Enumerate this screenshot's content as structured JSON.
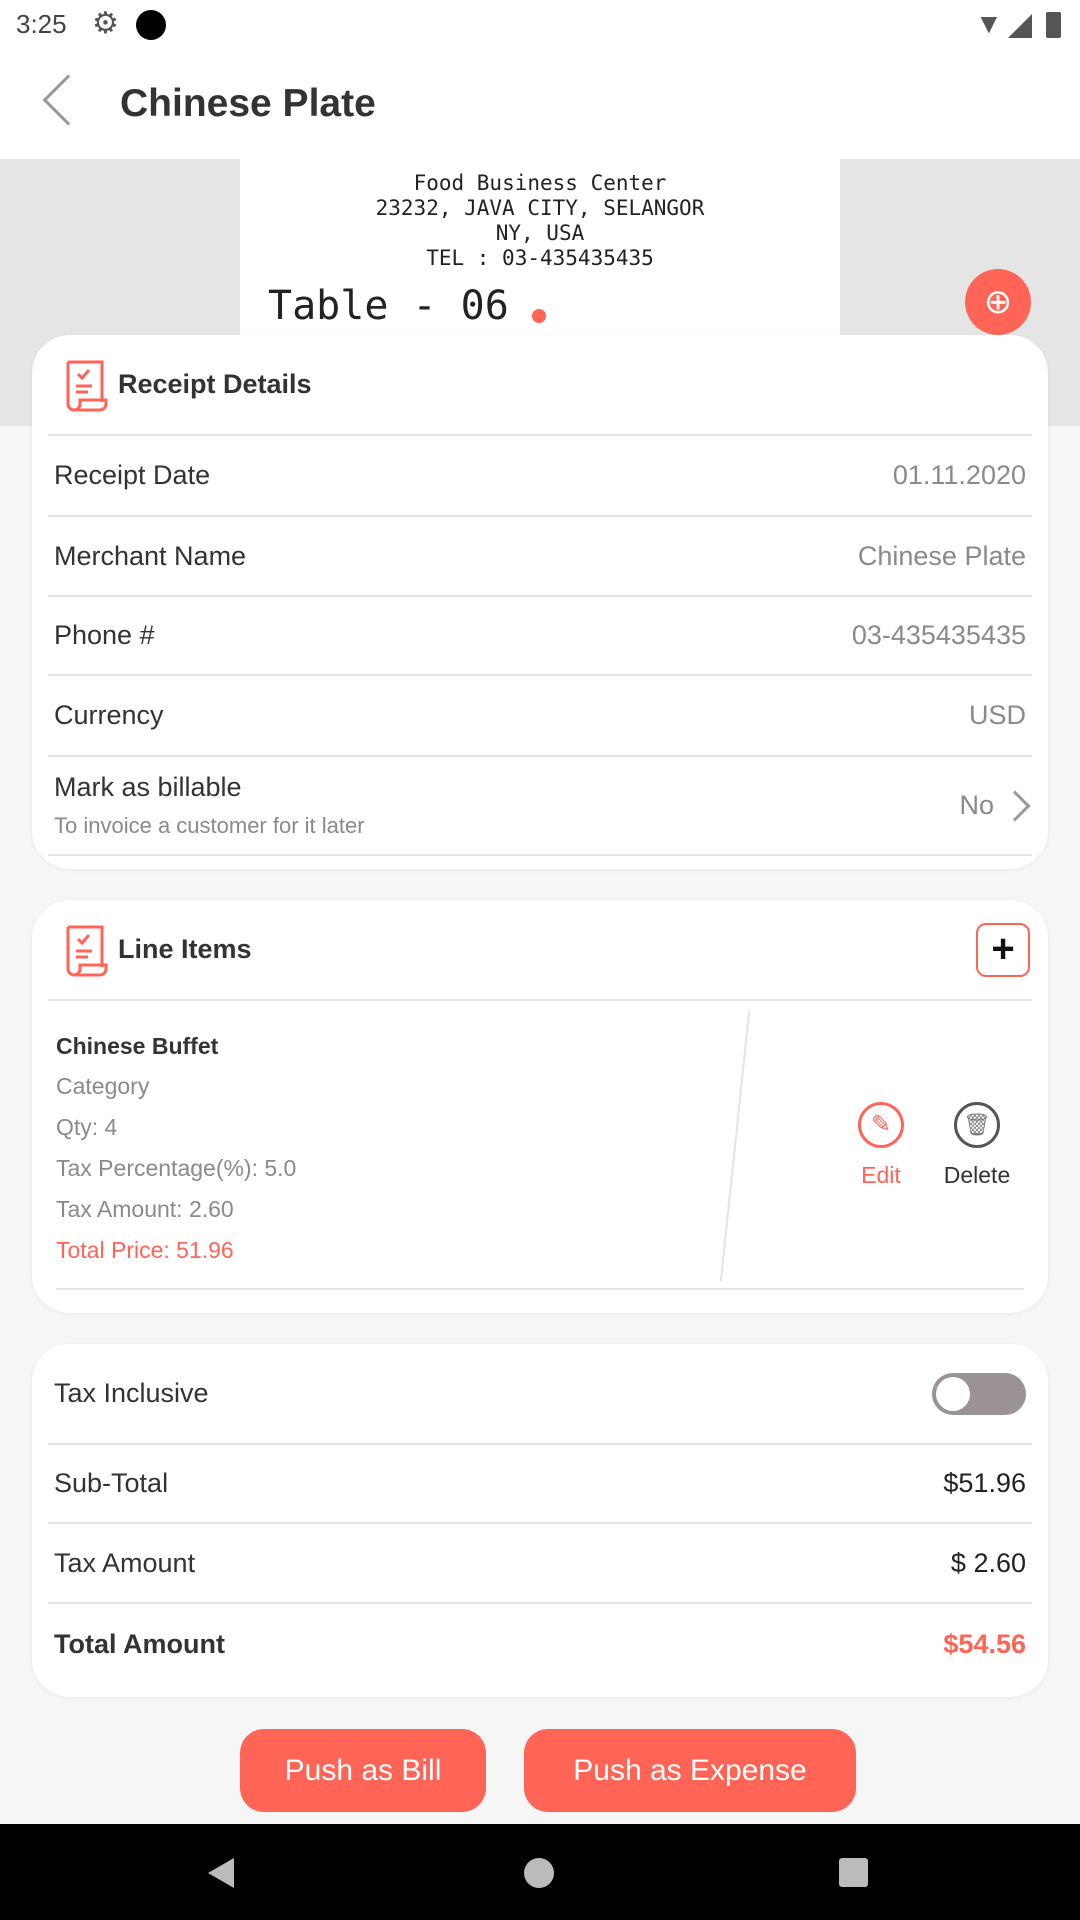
{
  "status_bar": {
    "time": "3:25"
  },
  "header": {
    "title": "Chinese Plate"
  },
  "receipt_image": {
    "lines": [
      "Food Business Center",
      "23232, JAVA CITY, SELANGOR",
      "NY, USA",
      "TEL : 03-435435435"
    ],
    "table": "Table - 06"
  },
  "receipt_details": {
    "title": "Receipt Details",
    "rows": [
      {
        "label": "Receipt Date",
        "value": "01.11.2020"
      },
      {
        "label": "Merchant Name",
        "value": "Chinese Plate"
      },
      {
        "label": "Phone #",
        "value": "03-435435435"
      },
      {
        "label": "Currency",
        "value": "USD"
      }
    ],
    "billable": {
      "label": "Mark as billable",
      "sub": "To invoice a customer for it later",
      "value": "No"
    }
  },
  "line_items": {
    "title": "Line Items",
    "items": [
      {
        "name": "Chinese Buffet",
        "category": "Category",
        "qty": "Qty: 4",
        "tax_pct": "Tax Percentage(%): 5.0",
        "tax_amount": "Tax Amount: 2.60",
        "total": "Total Price: 51.96"
      }
    ],
    "edit": "Edit",
    "delete": "Delete"
  },
  "totals": {
    "tax_inclusive": {
      "label": "Tax Inclusive",
      "on": false
    },
    "subtotal": {
      "label": "Sub-Total",
      "value": "$51.96"
    },
    "tax": {
      "label": "Tax Amount",
      "value": "$ 2.60"
    },
    "total": {
      "label": "Total Amount",
      "value": "$54.56"
    }
  },
  "actions": {
    "bill": "Push as Bill",
    "expense": "Push as Expense"
  },
  "colors": {
    "accent": "#ff6557"
  }
}
